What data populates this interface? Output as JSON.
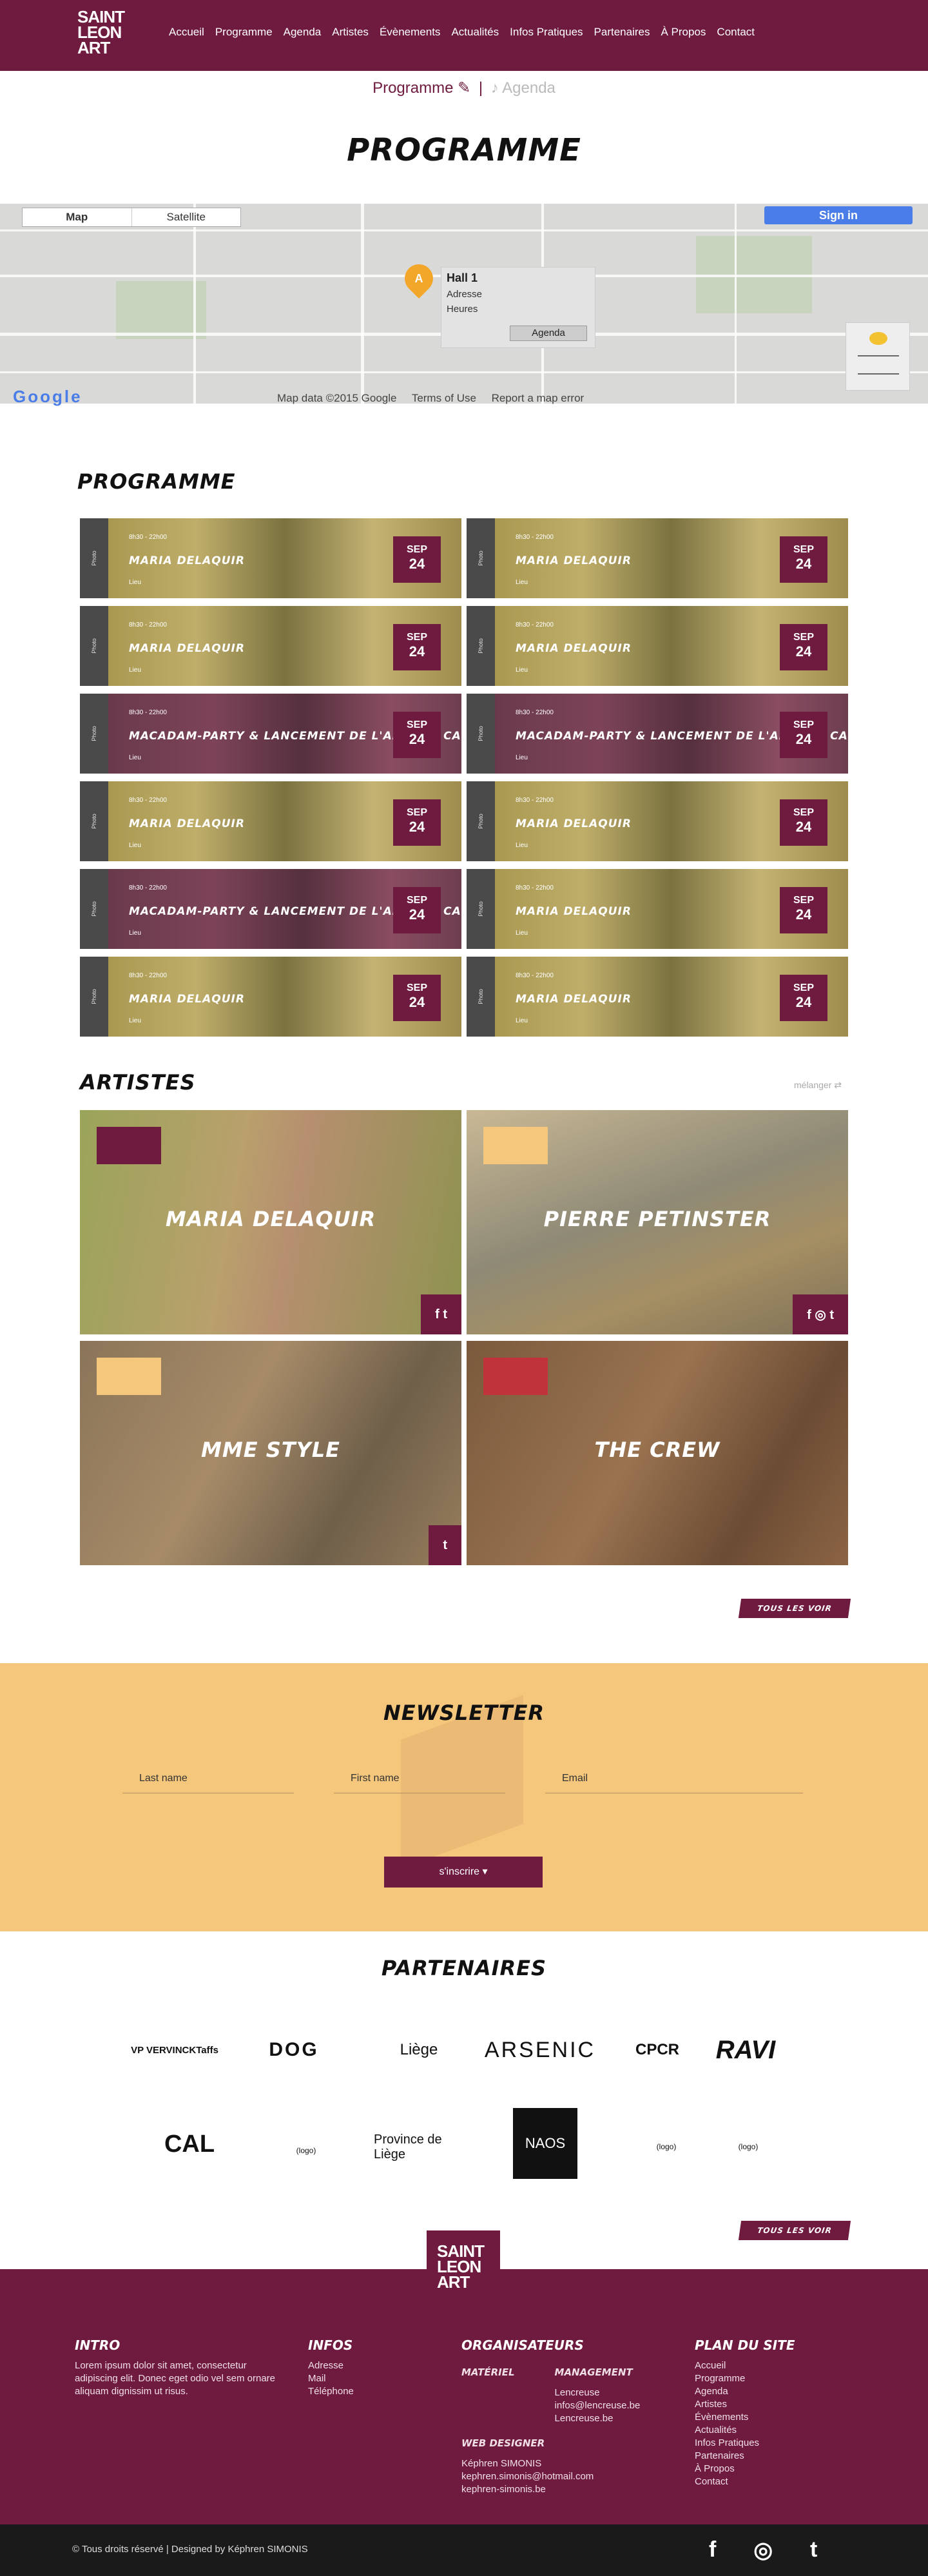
{
  "header": {
    "logo_line1": "SAINT",
    "logo_line2": "LEON",
    "logo_line3": "ART",
    "nav": [
      "Accueil",
      "Programme",
      "Agenda",
      "Artistes",
      "Évènements",
      "Actualités",
      "Infos Pratiques",
      "Partenaires",
      "À Propos",
      "Contact"
    ]
  },
  "tabs": {
    "programme": "Programme",
    "separator": "|",
    "agenda": "Agenda"
  },
  "page_title": "PROGRAMME",
  "map": {
    "toggle_map": "Map",
    "toggle_satellite": "Satellite",
    "sign_in": "Sign in",
    "marker": "A",
    "info_name": "Hall 1",
    "info_address": "Adresse",
    "info_hours": "Heures",
    "info_button": "Agenda",
    "google": "Google",
    "footer_data": "Map data ©2015 Google",
    "footer_terms": "Terms of Use",
    "footer_report": "Report a map error"
  },
  "programme": {
    "title": "PROGRAMME",
    "side_label": "Photo",
    "cards": [
      {
        "time": "8h30 - 22h00",
        "title": "MARIA DELAQUIR",
        "location": "Lieu",
        "month": "SEP",
        "day": "24",
        "tone": "g"
      },
      {
        "time": "8h30 - 22h00",
        "title": "MARIA DELAQUIR",
        "location": "Lieu",
        "month": "SEP",
        "day": "24",
        "tone": "g"
      },
      {
        "time": "8h30 - 22h00",
        "title": "MARIA DELAQUIR",
        "location": "Lieu",
        "month": "SEP",
        "day": "24",
        "tone": "g"
      },
      {
        "time": "8h30 - 22h00",
        "title": "MARIA DELAQUIR",
        "location": "Lieu",
        "month": "SEP",
        "day": "24",
        "tone": "g"
      },
      {
        "time": "8h30 - 22h00",
        "title": "MACADAM-PARTY & LANCEMENT DE L'APPEL À CANDIDATURE",
        "location": "Lieu",
        "month": "SEP",
        "day": "24",
        "tone": "p"
      },
      {
        "time": "8h30 - 22h00",
        "title": "MACADAM-PARTY & LANCEMENT DE L'APPEL À CANDIDATURE",
        "location": "Lieu",
        "month": "SEP",
        "day": "24",
        "tone": "p"
      },
      {
        "time": "8h30 - 22h00",
        "title": "MARIA DELAQUIR",
        "location": "Lieu",
        "month": "SEP",
        "day": "24",
        "tone": "g"
      },
      {
        "time": "8h30 - 22h00",
        "title": "MARIA DELAQUIR",
        "location": "Lieu",
        "month": "SEP",
        "day": "24",
        "tone": "g"
      },
      {
        "time": "8h30 - 22h00",
        "title": "MACADAM-PARTY & LANCEMENT DE L'APPEL À CANDIDATURE",
        "location": "Lieu",
        "month": "SEP",
        "day": "24",
        "tone": "p"
      },
      {
        "time": "8h30 - 22h00",
        "title": "MARIA DELAQUIR",
        "location": "Lieu",
        "month": "SEP",
        "day": "24",
        "tone": "g"
      },
      {
        "time": "8h30 - 22h00",
        "title": "MARIA DELAQUIR",
        "location": "Lieu",
        "month": "SEP",
        "day": "24",
        "tone": "g"
      },
      {
        "time": "8h30 - 22h00",
        "title": "MARIA DELAQUIR",
        "location": "Lieu",
        "month": "SEP",
        "day": "24",
        "tone": "g"
      }
    ]
  },
  "artists": {
    "title": "ARTISTES",
    "shuffle": "mélanger",
    "items": [
      {
        "name": "MARIA DELAQUIR",
        "tag_color": "#6f1a3f",
        "social": "f  t"
      },
      {
        "name": "PIERRE PETINSTER",
        "tag_color": "#f5c77c",
        "social": "f  ◎  t"
      },
      {
        "name": "MME STYLE",
        "tag_color": "#f5c77c",
        "social": "t"
      },
      {
        "name": "THE CREW",
        "tag_color": "#c0333a",
        "social": ""
      }
    ],
    "see_all": "TOUS LES VOIR"
  },
  "newsletter": {
    "title": "NEWSLETTER",
    "last_name": "Last name",
    "first_name": "First name",
    "email": "Email",
    "button": "s'inscrire ▾"
  },
  "partners": {
    "title": "PARTENAIRES",
    "logos": [
      "VP VERVINCKTaffs",
      "DOG",
      "Liège",
      "ARSENIC",
      "CPCR",
      "RAVI",
      "CAL",
      "(logo)",
      "Province de Liège",
      "NAOS",
      "(logo)",
      "(logo)"
    ],
    "see_all": "TOUS LES VOIR"
  },
  "footer": {
    "intro_title": "INTRO",
    "intro_text": "Lorem ipsum dolor sit amet, consectetur adipiscing elit. Donec eget odio vel sem ornare aliquam dignissim ut risus.",
    "infos_title": "INFOS",
    "infos": [
      "Adresse",
      "Mail",
      "Téléphone"
    ],
    "org_title": "ORGANISATEURS",
    "materiel": "MATÉRIEL",
    "management": "MANAGEMENT",
    "mgmt_lines": [
      "Lencreuse",
      "infos@lencreuse.be",
      "Lencreuse.be"
    ],
    "web_title": "WEB DESIGNER",
    "web_lines": [
      "Képhren SIMONIS",
      "kephren.simonis@hotmail.com",
      "kephren-simonis.be"
    ],
    "plan_title": "PLAN DU SITE",
    "plan": [
      "Accueil",
      "Programme",
      "Agenda",
      "Artistes",
      "Évènements",
      "Actualités",
      "Infos Pratiques",
      "Partenaires",
      "À Propos",
      "Contact"
    ],
    "copyright": "© Tous droits réservé | Designed by Képhren SIMONIS",
    "social": [
      "f",
      "◎",
      "t"
    ]
  }
}
